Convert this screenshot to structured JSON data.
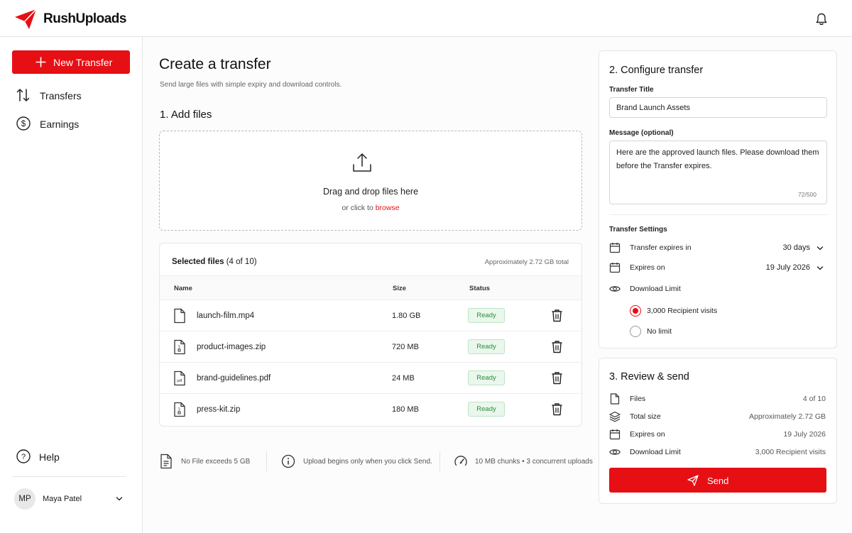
{
  "app": {
    "name": "RushUploads",
    "brand_color": "#e60f14"
  },
  "sidebar": {
    "new_transfer": "New Transfer",
    "items": [
      {
        "label": "Transfers",
        "icon": "arrows-up-down-icon"
      },
      {
        "label": "Earnings",
        "icon": "dollar-circle-icon"
      }
    ],
    "help": "Help",
    "user": {
      "initials": "MP",
      "name": "Maya Patel"
    }
  },
  "main": {
    "title": "Create a transfer",
    "subtitle": "Send large files with simple expiry and download controls.",
    "add_files_heading": "1. Add files",
    "dropzone": {
      "title": "Drag and drop files here",
      "prefix": "or click to",
      "browse": "browse"
    },
    "files": {
      "heading": "Selected files",
      "count": "(4 of 10)",
      "total": "Approximately 2.72 GB total",
      "columns": {
        "name": "Name",
        "size": "Size",
        "status": "Status"
      },
      "rows": [
        {
          "name": "launch-film.mp4",
          "size": "1.80 GB",
          "status": "Ready",
          "icon": "file-icon"
        },
        {
          "name": "product-images.zip",
          "size": "720 MB",
          "status": "Ready",
          "icon": "zip-file-icon"
        },
        {
          "name": "brand-guidelines.pdf",
          "size": "24 MB",
          "status": "Ready",
          "icon": "pdf-file-icon"
        },
        {
          "name": "press-kit.zip",
          "size": "180 MB",
          "status": "Ready",
          "icon": "zip-file-icon"
        }
      ]
    },
    "notes": [
      "No File exceeds 5 GB",
      "Upload begins only when you click Send.",
      "10 MB chunks • 3 concurrent uploads"
    ]
  },
  "configure": {
    "heading": "2. Configure transfer",
    "title_label": "Transfer Title",
    "title_value": "Brand Launch Assets",
    "message_label": "Message (optional)",
    "message_value": "Here are the approved launch files. Please download them before the Transfer expires.",
    "message_counter": "72/500",
    "settings_heading": "Transfer Settings",
    "expires_in_label": "Transfer expires in",
    "expires_in_value": "30 days",
    "expires_on_label": "Expires on",
    "expires_on_value": "19 July 2026",
    "download_limit_label": "Download Limit",
    "download_options": [
      "3,000 Recipient visits",
      "No limit"
    ],
    "download_selected": "3,000 Recipient visits"
  },
  "review": {
    "heading": "3. Review & send",
    "rows": [
      {
        "label": "Files",
        "value": "4 of 10"
      },
      {
        "label": "Total size",
        "value": "Approximately 2.72 GB"
      },
      {
        "label": "Expires on",
        "value": "19 July 2026"
      },
      {
        "label": "Download Limit",
        "value": "3,000 Recipient visits"
      }
    ],
    "send": "Send"
  }
}
